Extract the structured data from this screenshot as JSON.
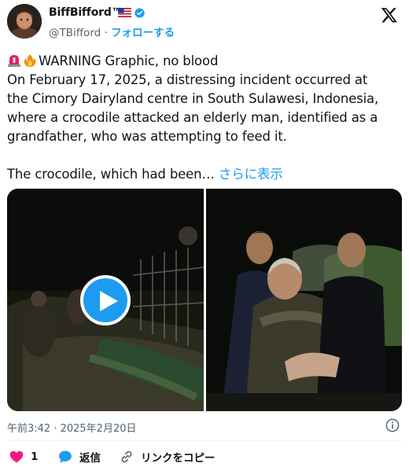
{
  "author": {
    "display_name": "BiffBifford™",
    "flag": "🇺🇸",
    "handle": "@TBifford",
    "separator": "·",
    "follow_label": "フォローする",
    "verified_color": "#1d9bf0"
  },
  "tweet": {
    "line1": "WARNING Graphic, no blood",
    "line2": "On February 17, 2025, a distressing incident occurred at",
    "line3": "the Cimory Dairyland centre in South Sulawesi, Indonesia,",
    "line4": "where a crocodile attacked an elderly man, identified as a",
    "line5": "grandfather, who was attempting to feed it.",
    "line6": "The crocodile, which had been…",
    "show_more_label": "さらに表示",
    "leading_icons": [
      "rotating-light-icon",
      "fire-icon"
    ]
  },
  "media": {
    "left_type": "video",
    "right_type": "image"
  },
  "meta": {
    "timestamp": "午前3:42 · 2025年2月20日"
  },
  "actions": {
    "like_count": "1",
    "reply_label": "返信",
    "copy_link_label": "リンクをコピー"
  },
  "colors": {
    "accent": "#1d9bf0",
    "like": "#f91880",
    "text": "#0f1419",
    "secondary": "#536471"
  }
}
